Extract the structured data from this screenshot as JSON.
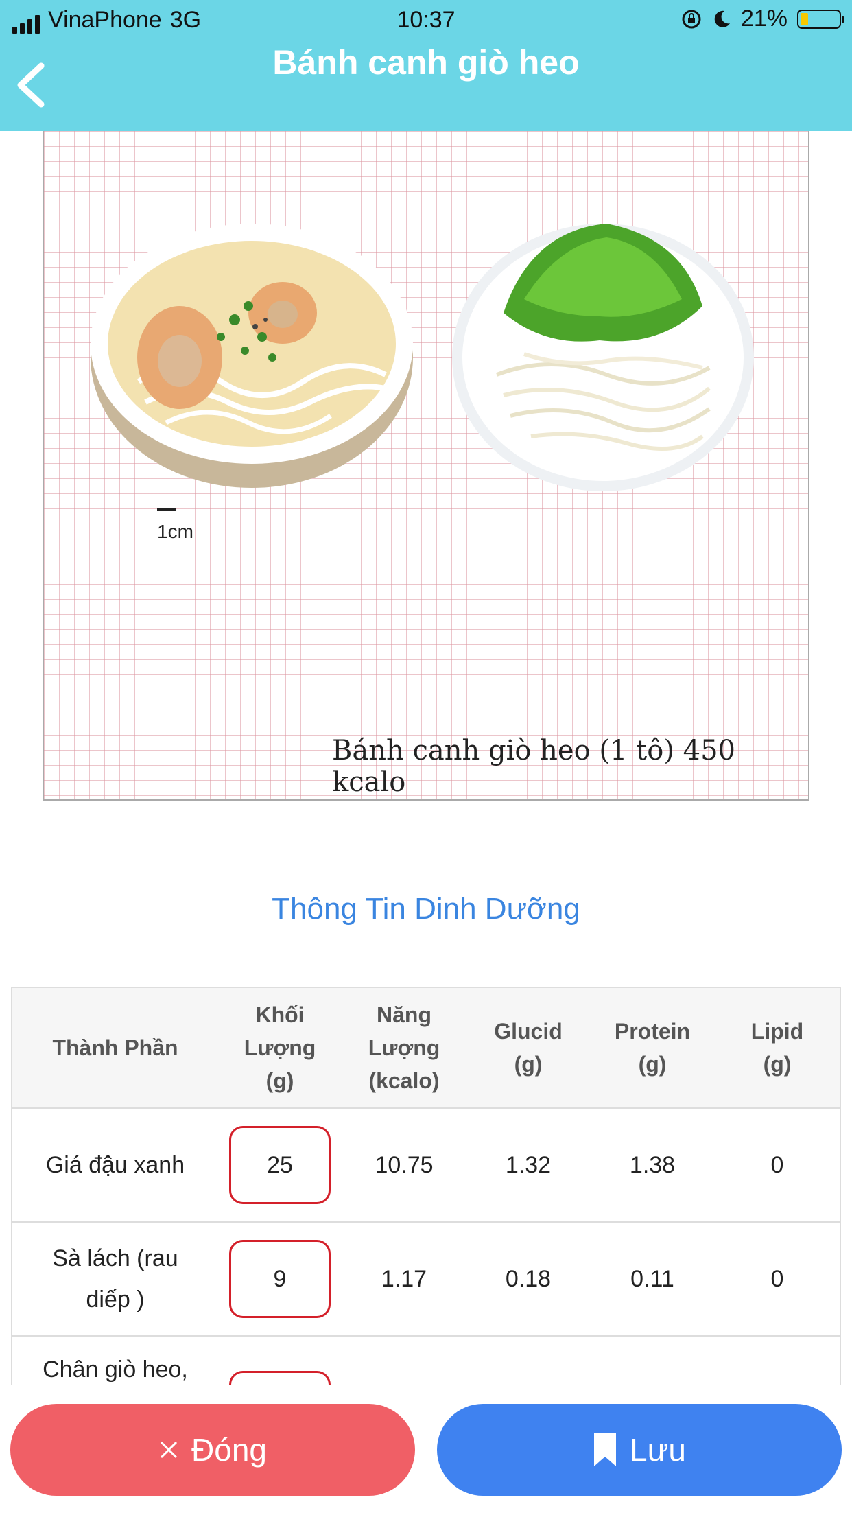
{
  "status_bar": {
    "carrier": "VinaPhone",
    "network": "3G",
    "time": "10:37",
    "battery": "21%"
  },
  "header": {
    "title": "Bánh canh giò heo"
  },
  "photo": {
    "scale_label": "1cm",
    "caption": "Bánh canh giò heo (1 tô) 450 kcalo"
  },
  "section_title": "Thông Tin Dinh Dưỡng",
  "table": {
    "headers": {
      "component": "Thành Phần",
      "mass": [
        "Khối",
        "Lượng",
        "(g)"
      ],
      "energy": [
        "Năng",
        "Lượng",
        "(kcalo)"
      ],
      "glucid": [
        "Glucid",
        "(g)"
      ],
      "protein": [
        "Protein",
        "(g)"
      ],
      "lipid": [
        "Lipid",
        "(g)"
      ]
    },
    "rows": [
      {
        "name": "Giá đậu xanh",
        "mass": "25",
        "energy": "10.75",
        "glucid": "1.32",
        "protein": "1.38",
        "lipid": "0"
      },
      {
        "name": "Sà lách (rau diếp )",
        "mass": "9",
        "energy": "1.17",
        "glucid": "0.18",
        "protein": "0.11",
        "lipid": "0"
      },
      {
        "name": "Chân giò heo,",
        "mass": "",
        "energy": "",
        "glucid": "",
        "protein": "",
        "lipid": ""
      }
    ]
  },
  "footer": {
    "close_label": "Đóng",
    "save_label": "Lưu"
  },
  "colors": {
    "header": "#6bd6e6",
    "accent_blue": "#3f82f0",
    "close_red": "#f05f66",
    "input_border": "#d4202a"
  }
}
